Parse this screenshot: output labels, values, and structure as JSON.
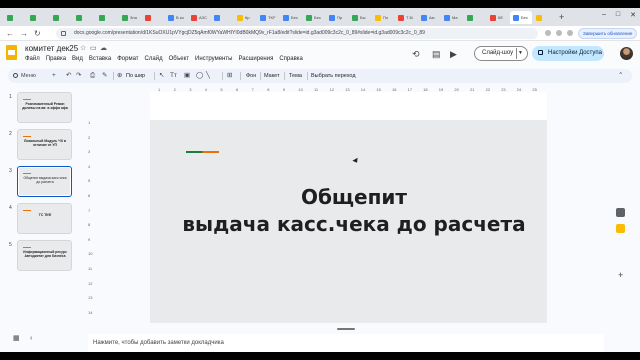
{
  "browser": {
    "tabs": [
      {
        "title": "",
        "color": "#34a853"
      },
      {
        "title": "",
        "color": "#34a853"
      },
      {
        "title": "",
        "color": "#34a853"
      },
      {
        "title": "",
        "color": "#34a853"
      },
      {
        "title": "",
        "color": "#34a853"
      },
      {
        "title": "Зна",
        "color": "#34a853"
      },
      {
        "title": "",
        "color": "#ea4335"
      },
      {
        "title": "В ко",
        "color": "#4285f4"
      },
      {
        "title": "АЗС",
        "color": "#ea4335"
      },
      {
        "title": "",
        "color": "#4285f4"
      },
      {
        "title": "Кр",
        "color": "#fbbc04"
      },
      {
        "title": "TKF",
        "color": "#4285f4"
      },
      {
        "title": "Без",
        "color": "#4285f4"
      },
      {
        "title": "Без",
        "color": "#34a853"
      },
      {
        "title": "Пр",
        "color": "#4285f4"
      },
      {
        "title": "Бы",
        "color": "#34a853"
      },
      {
        "title": "По",
        "color": "#fbbc04"
      },
      {
        "title": "Т Бі",
        "color": "#ea4335"
      },
      {
        "title": "Аю",
        "color": "#4285f4"
      },
      {
        "title": "Ма",
        "color": "#4285f4"
      },
      {
        "title": "",
        "color": "#34a853"
      },
      {
        "title": "КЕ",
        "color": "#ea4335"
      },
      {
        "title": "Без",
        "color": "#4285f4"
      },
      {
        "title": "",
        "color": "#fbbc04"
      }
    ],
    "new_tab": "+",
    "url": "docs.google.com/presentation/d/1KSuOXU1pVYgcjDZ5qAmf0WYaWHIYI0dB0kMQ9v_rF1a8/edit?slide=id.g3ad009c3c2c_0_89#slide=id.g3ad009c3c2c_0_89",
    "update_label": "Завершить обновление"
  },
  "document": {
    "title": "комитет дек25",
    "menu": [
      "Файл",
      "Правка",
      "Вид",
      "Вставка",
      "Формат",
      "Слайд",
      "Объект",
      "Инструменты",
      "Расширения",
      "Справка"
    ],
    "slideshow_label": "Слайд-шоу",
    "share_label": "Настройки Доступа"
  },
  "toolbar": {
    "search_label": "Меню",
    "zoom_label": "По шир",
    "background_label": "Фон",
    "layout_label": "Макет",
    "theme_label": "Тема",
    "transition_label": "Выбрать переход"
  },
  "filmstrip": {
    "slides": [
      {
        "number": "1",
        "text": "Розничаменный Ремин дилевы на ав: в эффа афа"
      },
      {
        "number": "2",
        "text": "Локальный Модуль ЧХ в отличие от УП"
      },
      {
        "number": "3",
        "text": "Общепит выдача касс.чека до расчета",
        "selected": true
      },
      {
        "number": "4",
        "text": "ТС ТКФ"
      },
      {
        "number": "5",
        "text": "Информационный ресурс Автодиктат для бизнеса"
      }
    ]
  },
  "ruler": {
    "top": [
      "1",
      "2",
      "3",
      "4",
      "5",
      "6",
      "7",
      "8",
      "9",
      "10",
      "11",
      "12",
      "13",
      "14",
      "15",
      "16",
      "17",
      "18",
      "19",
      "20",
      "21",
      "22",
      "23",
      "24",
      "25"
    ],
    "left": [
      "1",
      "2",
      "3",
      "4",
      "5",
      "6",
      "7",
      "8",
      "9",
      "10",
      "11",
      "12",
      "13",
      "14"
    ]
  },
  "slide": {
    "title_line1": "Общепит",
    "title_line2": "выдача касс.чека до расчета"
  },
  "notes": {
    "placeholder": "Нажмите, чтобы добавить заметки докладчика"
  },
  "colors": {
    "accent_green": "#188038",
    "accent_orange": "#e8710a",
    "share_bg": "#c2e7ff",
    "selection_border": "#0b57d0"
  }
}
